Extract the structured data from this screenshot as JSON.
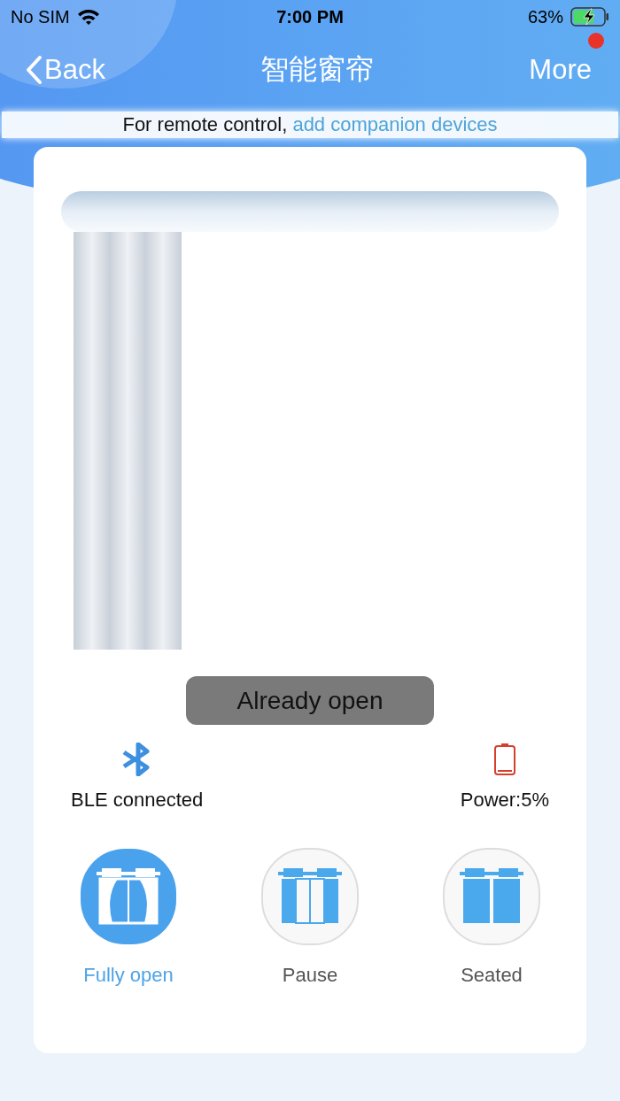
{
  "status_bar": {
    "carrier": "No SIM",
    "time": "7:00 PM",
    "battery": "63%"
  },
  "nav": {
    "back": "Back",
    "title": "智能窗帘",
    "more": "More",
    "notification": true
  },
  "banner": {
    "text": "For remote control, ",
    "link": "add companion devices"
  },
  "toast": "Already open",
  "device": {
    "connection": "BLE connected",
    "power": "Power:5%"
  },
  "modes": [
    {
      "kind": "open",
      "label": "Fully open",
      "selected": true
    },
    {
      "kind": "pause",
      "label": "Pause",
      "selected": false
    },
    {
      "kind": "close",
      "label": "Seated",
      "selected": false
    }
  ]
}
